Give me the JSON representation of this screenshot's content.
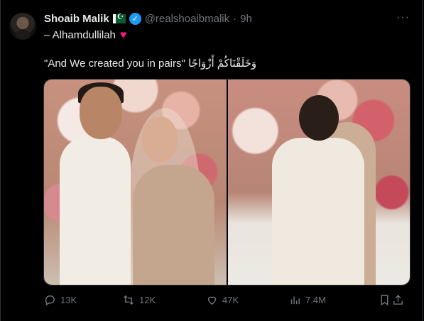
{
  "tweet": {
    "author_name": "Shoaib Malik",
    "handle": "@realshoaibmalik",
    "separator": "·",
    "time": "9h",
    "line1_text": "– Alhamdullilah",
    "line2_text": "\"And We created you in pairs\" وَخَلَقْنَاكُمْ أَزْوَاجًا"
  },
  "icons": {
    "more": "more-icon",
    "reply": "reply-icon",
    "retweet": "retweet-icon",
    "like": "heart-icon",
    "views": "views-icon",
    "bookmark": "bookmark-icon",
    "share": "share-icon"
  },
  "actions": {
    "reply_count": "13K",
    "retweet_count": "12K",
    "like_count": "47K",
    "views_count": "7.4M"
  },
  "colors": {
    "accent": "#1d9bf0",
    "heart": "#f91880",
    "muted": "#71767b",
    "text": "#e7e9ea",
    "background": "#000000"
  }
}
